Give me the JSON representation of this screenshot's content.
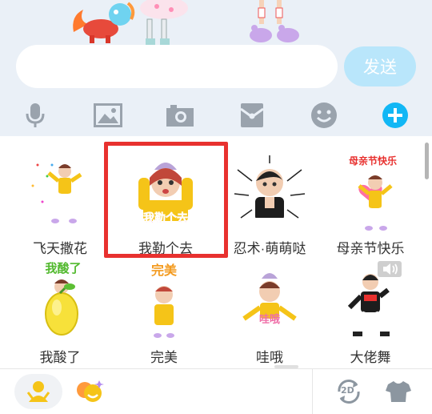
{
  "composer": {
    "input_value": "",
    "send_label": "发送"
  },
  "toolbar": {
    "items": [
      "microphone-icon",
      "image-icon",
      "camera-icon",
      "red-packet-icon",
      "emoji-icon",
      "plus-icon"
    ]
  },
  "stickers": {
    "items": [
      {
        "label": "飞天撒花",
        "overlay": ""
      },
      {
        "label": "我勒个去",
        "overlay": "我勒个去"
      },
      {
        "label": "忍术·萌萌哒",
        "overlay": ""
      },
      {
        "label": "母亲节快乐",
        "overlay": "母亲节快乐"
      },
      {
        "label": "我酸了",
        "overlay": "我酸了"
      },
      {
        "label": "完美",
        "overlay": "完美"
      },
      {
        "label": "哇哦",
        "overlay": "哇哦"
      },
      {
        "label": "大佬舞",
        "overlay": ""
      }
    ],
    "selected_index": 1
  },
  "bottom_bar": {
    "tabs": [
      "avatar-sticker-icon",
      "emoji-pack-icon",
      "2d-toggle-icon",
      "outfit-icon"
    ],
    "toggle_text": "2D"
  },
  "colors": {
    "accent": "#12b7f5",
    "send_disabled": "#b9e6fb",
    "selection": "#e8312f",
    "toolbar_icon": "#9aa3ad",
    "top_background": "#eaf0f7"
  }
}
